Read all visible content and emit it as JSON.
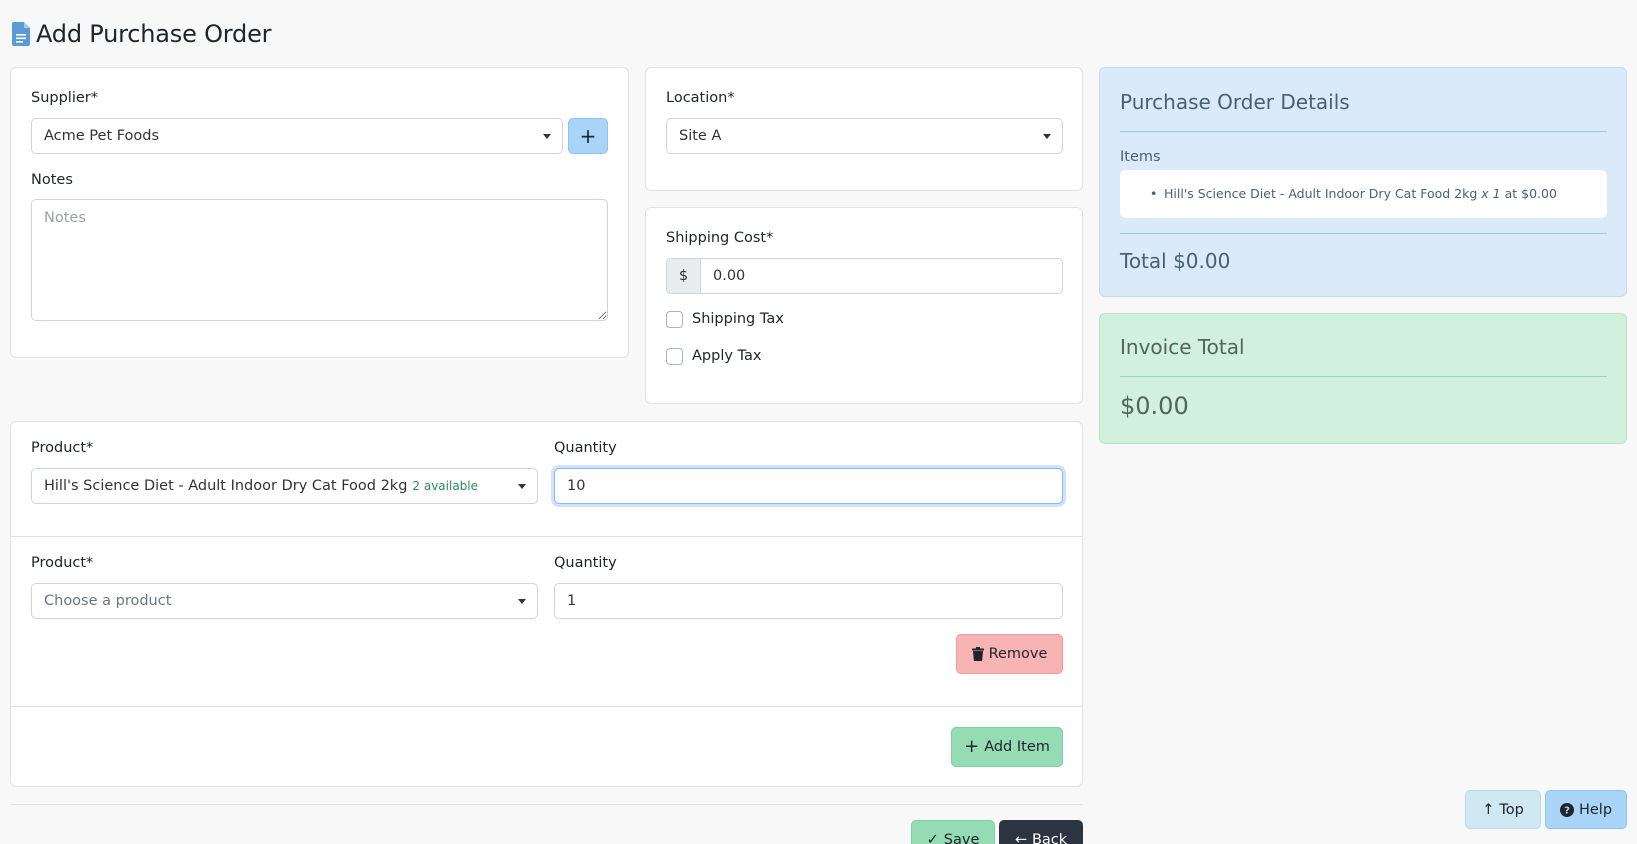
{
  "header": {
    "title": "Add Purchase Order",
    "icon": "document-icon"
  },
  "supplier": {
    "label": "Supplier*",
    "value": "Acme Pet Foods",
    "add_label": "+"
  },
  "notes": {
    "label": "Notes",
    "placeholder": "Notes",
    "value": ""
  },
  "location": {
    "label": "Location*",
    "value": "Site A"
  },
  "shipping": {
    "label": "Shipping Cost*",
    "prefix": "$",
    "value": "0.00",
    "shipping_tax_label": "Shipping Tax",
    "apply_tax_label": "Apply Tax"
  },
  "items": [
    {
      "product_label": "Product*",
      "product_value": "Hill's Science Diet - Adult Indoor Dry Cat Food 2kg",
      "available": "2 available",
      "quantity_label": "Quantity",
      "quantity_value": "10"
    },
    {
      "product_label": "Product*",
      "product_placeholder": "Choose a product",
      "quantity_label": "Quantity",
      "quantity_value": "1",
      "remove_label": "Remove"
    }
  ],
  "add_item_label": "Add Item",
  "actions": {
    "save_label": "Save",
    "back_label": "Back"
  },
  "details": {
    "title": "Purchase Order Details",
    "items_label": "Items",
    "line_item_name": "Hill's Science Diet - Adult Indoor Dry Cat Food 2kg",
    "line_item_qty": "x 1",
    "line_item_price": "at $0.00",
    "total": "Total $0.00"
  },
  "invoice": {
    "title": "Invoice Total",
    "amount": "$0.00"
  },
  "float_buttons": {
    "top_label": "Top",
    "help_label": "Help"
  },
  "colors": {
    "details_bg": "#dbeafb",
    "invoice_bg": "#d1f0de",
    "add_btn": "#a8d4f7",
    "remove_btn": "#f8b4b4",
    "add_item_btn": "#95dcb4",
    "save_btn": "#95dcb4",
    "back_btn": "#2b3440"
  }
}
